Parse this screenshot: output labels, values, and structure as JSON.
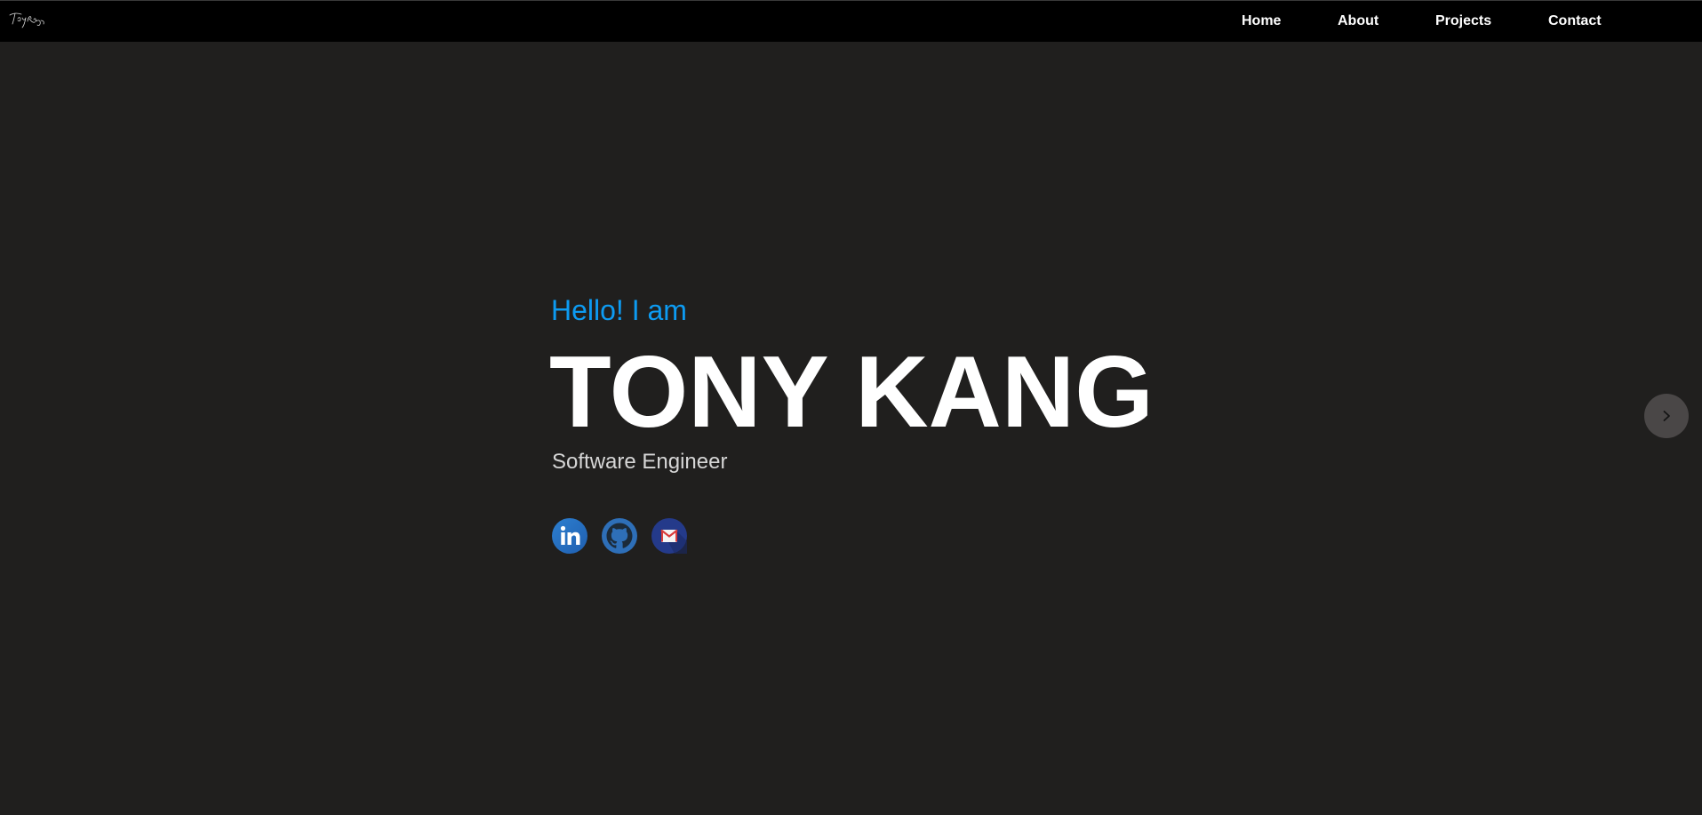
{
  "brand": {
    "logo_icon": "signature-logo-icon"
  },
  "nav": {
    "items": [
      {
        "label": "Home"
      },
      {
        "label": "About"
      },
      {
        "label": "Projects"
      },
      {
        "label": "Contact"
      }
    ]
  },
  "hero": {
    "greeting": "Hello! I am",
    "name": "TONY KANG",
    "role": "Software Engineer"
  },
  "socials": [
    {
      "icon": "linkedin-icon"
    },
    {
      "icon": "github-icon"
    },
    {
      "icon": "gmail-icon"
    }
  ],
  "carousel": {
    "next_icon": "chevron-right-icon"
  },
  "colors": {
    "background": "#201f1e",
    "navbar": "#000000",
    "accent": "#0d9bf2",
    "name_text": "#ffffff",
    "role_text": "#d6d6d6",
    "next_button": "#4a4747"
  }
}
